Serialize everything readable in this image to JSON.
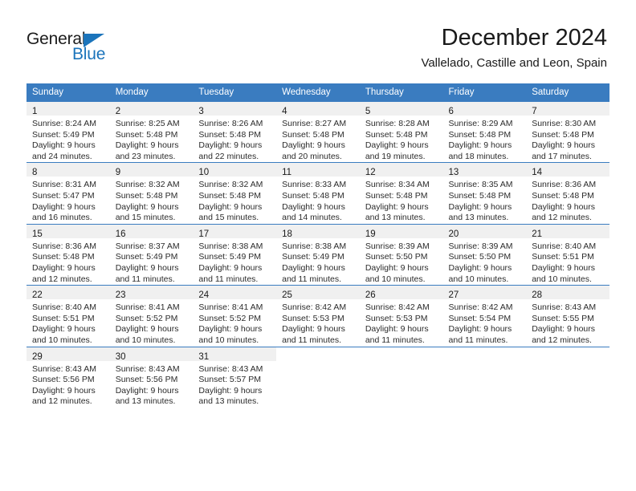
{
  "brand": {
    "name_part1": "General",
    "name_part2": "Blue",
    "triangle_icon": "triangle-icon",
    "accent_color": "#1b74bb"
  },
  "header": {
    "title": "December 2024",
    "subtitle": "Vallelado, Castille and Leon, Spain"
  },
  "calendar": {
    "header_bg": "#3a7cc0",
    "daynum_bg": "#f0f0f0",
    "weekday_headers": [
      "Sunday",
      "Monday",
      "Tuesday",
      "Wednesday",
      "Thursday",
      "Friday",
      "Saturday"
    ],
    "weeks": [
      [
        {
          "day": "1",
          "sunrise": "Sunrise: 8:24 AM",
          "sunset": "Sunset: 5:49 PM",
          "daylight_line1": "Daylight: 9 hours",
          "daylight_line2": "and 24 minutes."
        },
        {
          "day": "2",
          "sunrise": "Sunrise: 8:25 AM",
          "sunset": "Sunset: 5:48 PM",
          "daylight_line1": "Daylight: 9 hours",
          "daylight_line2": "and 23 minutes."
        },
        {
          "day": "3",
          "sunrise": "Sunrise: 8:26 AM",
          "sunset": "Sunset: 5:48 PM",
          "daylight_line1": "Daylight: 9 hours",
          "daylight_line2": "and 22 minutes."
        },
        {
          "day": "4",
          "sunrise": "Sunrise: 8:27 AM",
          "sunset": "Sunset: 5:48 PM",
          "daylight_line1": "Daylight: 9 hours",
          "daylight_line2": "and 20 minutes."
        },
        {
          "day": "5",
          "sunrise": "Sunrise: 8:28 AM",
          "sunset": "Sunset: 5:48 PM",
          "daylight_line1": "Daylight: 9 hours",
          "daylight_line2": "and 19 minutes."
        },
        {
          "day": "6",
          "sunrise": "Sunrise: 8:29 AM",
          "sunset": "Sunset: 5:48 PM",
          "daylight_line1": "Daylight: 9 hours",
          "daylight_line2": "and 18 minutes."
        },
        {
          "day": "7",
          "sunrise": "Sunrise: 8:30 AM",
          "sunset": "Sunset: 5:48 PM",
          "daylight_line1": "Daylight: 9 hours",
          "daylight_line2": "and 17 minutes."
        }
      ],
      [
        {
          "day": "8",
          "sunrise": "Sunrise: 8:31 AM",
          "sunset": "Sunset: 5:47 PM",
          "daylight_line1": "Daylight: 9 hours",
          "daylight_line2": "and 16 minutes."
        },
        {
          "day": "9",
          "sunrise": "Sunrise: 8:32 AM",
          "sunset": "Sunset: 5:48 PM",
          "daylight_line1": "Daylight: 9 hours",
          "daylight_line2": "and 15 minutes."
        },
        {
          "day": "10",
          "sunrise": "Sunrise: 8:32 AM",
          "sunset": "Sunset: 5:48 PM",
          "daylight_line1": "Daylight: 9 hours",
          "daylight_line2": "and 15 minutes."
        },
        {
          "day": "11",
          "sunrise": "Sunrise: 8:33 AM",
          "sunset": "Sunset: 5:48 PM",
          "daylight_line1": "Daylight: 9 hours",
          "daylight_line2": "and 14 minutes."
        },
        {
          "day": "12",
          "sunrise": "Sunrise: 8:34 AM",
          "sunset": "Sunset: 5:48 PM",
          "daylight_line1": "Daylight: 9 hours",
          "daylight_line2": "and 13 minutes."
        },
        {
          "day": "13",
          "sunrise": "Sunrise: 8:35 AM",
          "sunset": "Sunset: 5:48 PM",
          "daylight_line1": "Daylight: 9 hours",
          "daylight_line2": "and 13 minutes."
        },
        {
          "day": "14",
          "sunrise": "Sunrise: 8:36 AM",
          "sunset": "Sunset: 5:48 PM",
          "daylight_line1": "Daylight: 9 hours",
          "daylight_line2": "and 12 minutes."
        }
      ],
      [
        {
          "day": "15",
          "sunrise": "Sunrise: 8:36 AM",
          "sunset": "Sunset: 5:48 PM",
          "daylight_line1": "Daylight: 9 hours",
          "daylight_line2": "and 12 minutes."
        },
        {
          "day": "16",
          "sunrise": "Sunrise: 8:37 AM",
          "sunset": "Sunset: 5:49 PM",
          "daylight_line1": "Daylight: 9 hours",
          "daylight_line2": "and 11 minutes."
        },
        {
          "day": "17",
          "sunrise": "Sunrise: 8:38 AM",
          "sunset": "Sunset: 5:49 PM",
          "daylight_line1": "Daylight: 9 hours",
          "daylight_line2": "and 11 minutes."
        },
        {
          "day": "18",
          "sunrise": "Sunrise: 8:38 AM",
          "sunset": "Sunset: 5:49 PM",
          "daylight_line1": "Daylight: 9 hours",
          "daylight_line2": "and 11 minutes."
        },
        {
          "day": "19",
          "sunrise": "Sunrise: 8:39 AM",
          "sunset": "Sunset: 5:50 PM",
          "daylight_line1": "Daylight: 9 hours",
          "daylight_line2": "and 10 minutes."
        },
        {
          "day": "20",
          "sunrise": "Sunrise: 8:39 AM",
          "sunset": "Sunset: 5:50 PM",
          "daylight_line1": "Daylight: 9 hours",
          "daylight_line2": "and 10 minutes."
        },
        {
          "day": "21",
          "sunrise": "Sunrise: 8:40 AM",
          "sunset": "Sunset: 5:51 PM",
          "daylight_line1": "Daylight: 9 hours",
          "daylight_line2": "and 10 minutes."
        }
      ],
      [
        {
          "day": "22",
          "sunrise": "Sunrise: 8:40 AM",
          "sunset": "Sunset: 5:51 PM",
          "daylight_line1": "Daylight: 9 hours",
          "daylight_line2": "and 10 minutes."
        },
        {
          "day": "23",
          "sunrise": "Sunrise: 8:41 AM",
          "sunset": "Sunset: 5:52 PM",
          "daylight_line1": "Daylight: 9 hours",
          "daylight_line2": "and 10 minutes."
        },
        {
          "day": "24",
          "sunrise": "Sunrise: 8:41 AM",
          "sunset": "Sunset: 5:52 PM",
          "daylight_line1": "Daylight: 9 hours",
          "daylight_line2": "and 10 minutes."
        },
        {
          "day": "25",
          "sunrise": "Sunrise: 8:42 AM",
          "sunset": "Sunset: 5:53 PM",
          "daylight_line1": "Daylight: 9 hours",
          "daylight_line2": "and 11 minutes."
        },
        {
          "day": "26",
          "sunrise": "Sunrise: 8:42 AM",
          "sunset": "Sunset: 5:53 PM",
          "daylight_line1": "Daylight: 9 hours",
          "daylight_line2": "and 11 minutes."
        },
        {
          "day": "27",
          "sunrise": "Sunrise: 8:42 AM",
          "sunset": "Sunset: 5:54 PM",
          "daylight_line1": "Daylight: 9 hours",
          "daylight_line2": "and 11 minutes."
        },
        {
          "day": "28",
          "sunrise": "Sunrise: 8:43 AM",
          "sunset": "Sunset: 5:55 PM",
          "daylight_line1": "Daylight: 9 hours",
          "daylight_line2": "and 12 minutes."
        }
      ],
      [
        {
          "day": "29",
          "sunrise": "Sunrise: 8:43 AM",
          "sunset": "Sunset: 5:56 PM",
          "daylight_line1": "Daylight: 9 hours",
          "daylight_line2": "and 12 minutes."
        },
        {
          "day": "30",
          "sunrise": "Sunrise: 8:43 AM",
          "sunset": "Sunset: 5:56 PM",
          "daylight_line1": "Daylight: 9 hours",
          "daylight_line2": "and 13 minutes."
        },
        {
          "day": "31",
          "sunrise": "Sunrise: 8:43 AM",
          "sunset": "Sunset: 5:57 PM",
          "daylight_line1": "Daylight: 9 hours",
          "daylight_line2": "and 13 minutes."
        },
        null,
        null,
        null,
        null
      ]
    ]
  }
}
